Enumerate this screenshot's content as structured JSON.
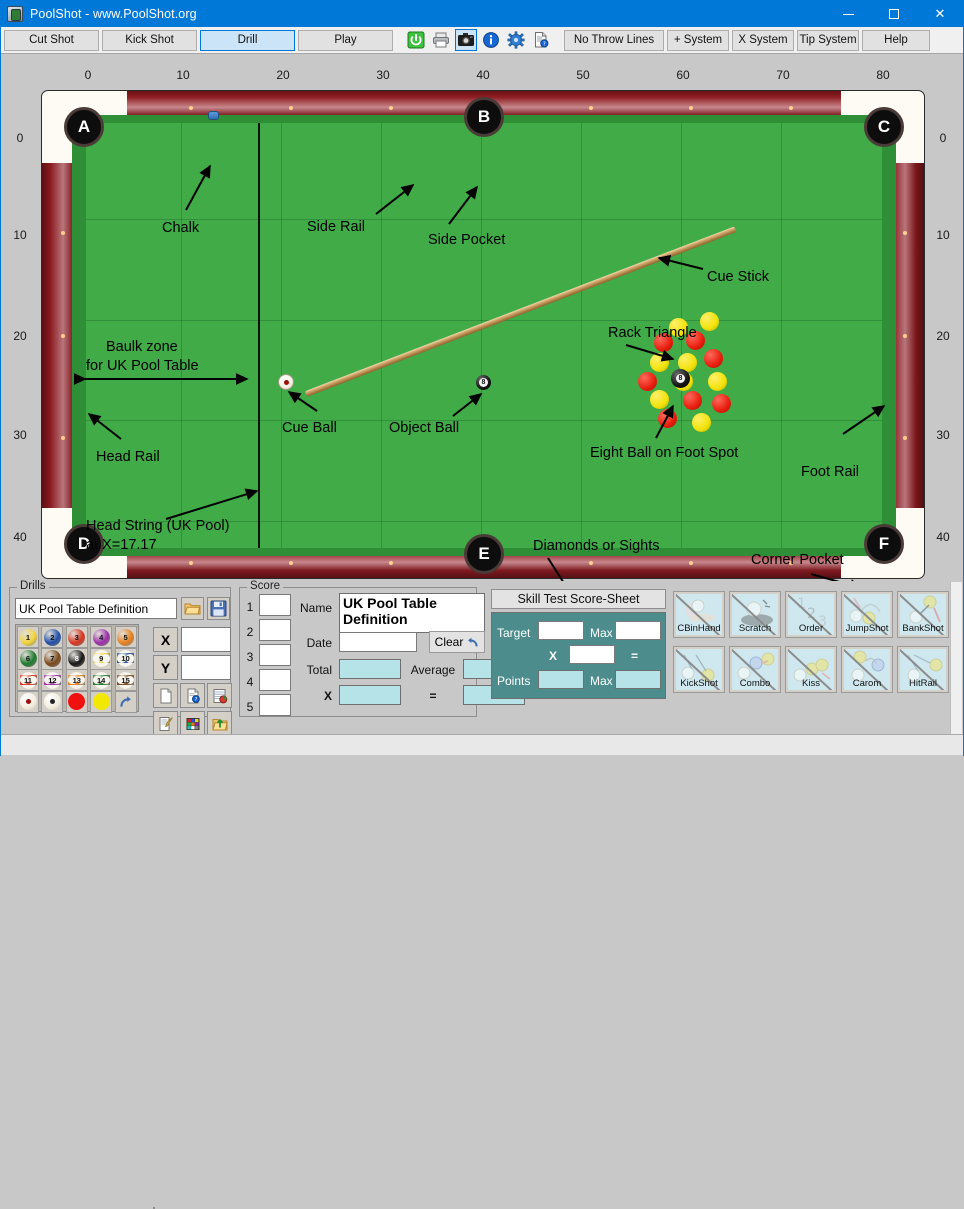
{
  "window": {
    "title": "PoolShot - www.PoolShot.org",
    "icon": "poolshot-app-icon",
    "minimize": "minimize-icon",
    "maximize": "maximize-icon",
    "close": "close-icon"
  },
  "toolbar": {
    "mode_buttons": [
      {
        "label": "Cut Shot",
        "selected": false
      },
      {
        "label": "Kick Shot",
        "selected": false
      },
      {
        "label": "Drill",
        "selected": true
      },
      {
        "label": "Play",
        "selected": false
      }
    ],
    "icon_buttons": [
      {
        "name": "power-icon",
        "selected": false
      },
      {
        "name": "printer-icon",
        "selected": false
      },
      {
        "name": "camera-icon",
        "selected": true
      },
      {
        "name": "info-icon",
        "selected": false
      },
      {
        "name": "gear-icon",
        "selected": false
      },
      {
        "name": "document-help-icon",
        "selected": false
      }
    ],
    "option_buttons": [
      {
        "label": "No Throw Lines"
      },
      {
        "label": "+ System"
      },
      {
        "label": "X System"
      },
      {
        "label": "Tip System"
      }
    ],
    "help_label": "Help"
  },
  "table_view": {
    "x_ruler": [
      "0",
      "10",
      "20",
      "30",
      "40",
      "50",
      "60",
      "70",
      "80"
    ],
    "y_ruler_left": [
      "0",
      "10",
      "20",
      "30",
      "40"
    ],
    "y_ruler_right": [
      "0",
      "10",
      "20",
      "30",
      "40"
    ],
    "pockets": [
      "A",
      "B",
      "C",
      "D",
      "E",
      "F"
    ],
    "annotations": [
      {
        "text": "Chalk"
      },
      {
        "text": "Side Rail"
      },
      {
        "text": "Side Pocket"
      },
      {
        "text": "Cue Stick"
      },
      {
        "text": "Rack Triangle"
      },
      {
        "text": "Baulk zone"
      },
      {
        "text": "for UK Pool Table"
      },
      {
        "text": "Cue Ball"
      },
      {
        "text": "Object Ball"
      },
      {
        "text": "Eight Ball on Foot Spot"
      },
      {
        "text": "Head Rail"
      },
      {
        "text": "Foot Rail"
      },
      {
        "text": "Head String (UK Pool)"
      },
      {
        "text": "at X=17.17"
      },
      {
        "text": "Diamonds or Sights"
      },
      {
        "text": "Corner Pocket"
      }
    ],
    "eight_ball_label": "8",
    "object_ball_label": "8",
    "colors": {
      "cloth": "#40ab47",
      "cushion": "#2f8f36",
      "rail_wood": "#8e1d22",
      "pocket": "#0d0d0d"
    }
  },
  "drills_panel": {
    "group_label": "Drills",
    "drill_name_value": "UK Pool Table Definition",
    "open_icon": "open-folder-icon",
    "save_icon": "save-disk-icon",
    "x_label": "X",
    "y_label": "Y",
    "x_value": "",
    "y_value": "",
    "balls": [
      {
        "num": "1",
        "color": "#f2d43c",
        "stripe": false
      },
      {
        "num": "2",
        "color": "#1f4fa8",
        "stripe": false
      },
      {
        "num": "3",
        "color": "#d8341f",
        "stripe": false
      },
      {
        "num": "4",
        "color": "#9b2fa8",
        "stripe": false
      },
      {
        "num": "5",
        "color": "#e8811d",
        "stripe": false
      },
      {
        "num": "6",
        "color": "#1f7a2e",
        "stripe": false
      },
      {
        "num": "7",
        "color": "#7a4a1c",
        "stripe": false
      },
      {
        "num": "8",
        "color": "#161616",
        "stripe": false
      },
      {
        "num": "9",
        "color": "#f2d43c",
        "stripe": true
      },
      {
        "num": "10",
        "color": "#1f4fa8",
        "stripe": true
      },
      {
        "num": "11",
        "color": "#d8341f",
        "stripe": true
      },
      {
        "num": "12",
        "color": "#9b2fa8",
        "stripe": true
      },
      {
        "num": "13",
        "color": "#e8811d",
        "stripe": true
      },
      {
        "num": "14",
        "color": "#1f7a2e",
        "stripe": true
      },
      {
        "num": "15",
        "color": "#7a4a1c",
        "stripe": true
      }
    ],
    "special_balls": [
      {
        "name": "cue-ball-red-dot-button"
      },
      {
        "name": "cue-ball-black-dot-button"
      },
      {
        "name": "red-ball-button"
      },
      {
        "name": "yellow-ball-button"
      },
      {
        "name": "undo-arrow-button"
      }
    ],
    "tool_icons": [
      {
        "name": "new-document-icon"
      },
      {
        "name": "document-help-icon"
      },
      {
        "name": "report-table-icon"
      },
      {
        "name": "edit-quill-icon"
      },
      {
        "name": "color-palette-icon"
      },
      {
        "name": "export-folder-icon"
      }
    ]
  },
  "score_panel": {
    "group_label": "Score",
    "rows": [
      "1",
      "2",
      "3",
      "4",
      "5"
    ],
    "row_values": [
      "",
      "",
      "",
      "",
      ""
    ],
    "name_label": "Name",
    "name_value": "UK Pool Table Definition",
    "date_label": "Date",
    "date_value": "",
    "clear_label": "Clear",
    "clear_icon": "undo-arrow-icon",
    "total_label": "Total",
    "total_value": "",
    "average_label": "Average",
    "average_value": "",
    "multiply_label": "X",
    "multiply_value": "",
    "equals_label": "=",
    "equals_value": ""
  },
  "skill_test": {
    "header": "Skill Test Score-Sheet",
    "target_label": "Target",
    "target_value": "",
    "target_max_label": "Max",
    "target_max_value": "",
    "x_label": "X",
    "x_value": "",
    "equals_label": "=",
    "points_label": "Points",
    "points_value": "",
    "points_max_label": "Max",
    "points_max_value": "",
    "background_color": "#4c8c8c"
  },
  "shot_types": [
    {
      "label": "CBinHand",
      "icon": "cue-ball-in-hand-icon",
      "disabled": true
    },
    {
      "label": "Scratch",
      "icon": "scratch-icon",
      "disabled": true
    },
    {
      "label": "Order",
      "icon": "ball-order-icon",
      "disabled": true
    },
    {
      "label": "JumpShot",
      "icon": "jump-shot-icon",
      "disabled": true
    },
    {
      "label": "BankShot",
      "icon": "bank-shot-icon",
      "disabled": true
    },
    {
      "label": "KickShot",
      "icon": "kick-shot-icon",
      "disabled": true
    },
    {
      "label": "Combo",
      "icon": "combo-shot-icon",
      "disabled": true
    },
    {
      "label": "Kiss",
      "icon": "kiss-shot-icon",
      "disabled": true
    },
    {
      "label": "Carom",
      "icon": "carom-shot-icon",
      "disabled": true
    },
    {
      "label": "HitRail",
      "icon": "hit-rail-icon",
      "disabled": true
    }
  ]
}
